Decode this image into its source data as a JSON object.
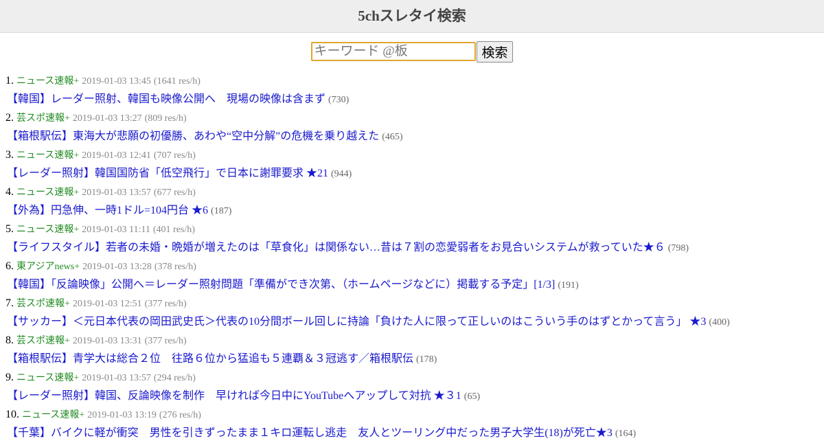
{
  "header": {
    "title": "5chスレタイ検索"
  },
  "search": {
    "placeholder": "キーワード @板",
    "button_label": "検索"
  },
  "results": [
    {
      "rank": "1.",
      "board": "ニュース速報+",
      "time": "2019-01-03 13:45",
      "rate": "(1641 res/h)",
      "title": "【韓国】レーダー照射、韓国も映像公開へ　現場の映像は含まず",
      "count": "(730)"
    },
    {
      "rank": "2.",
      "board": "芸スポ速報+",
      "time": "2019-01-03 13:27",
      "rate": "(809 res/h)",
      "title": "【箱根駅伝】東海大が悲願の初優勝、あわや“空中分解”の危機を乗り越えた",
      "count": "(465)"
    },
    {
      "rank": "3.",
      "board": "ニュース速報+",
      "time": "2019-01-03 12:41",
      "rate": "(707 res/h)",
      "title": "【レーダー照射】韓国国防省「低空飛行」で日本に謝罪要求 ★21",
      "count": "(944)"
    },
    {
      "rank": "4.",
      "board": "ニュース速報+",
      "time": "2019-01-03 13:57",
      "rate": "(677 res/h)",
      "title": "【外為】円急伸、一時1ドル=104円台 ★6",
      "count": "(187)"
    },
    {
      "rank": "5.",
      "board": "ニュース速報+",
      "time": "2019-01-03 11:11",
      "rate": "(401 res/h)",
      "title": "【ライフスタイル】若者の未婚・晩婚が増えたのは「草食化」は関係ない…昔は７割の恋愛弱者をお見合いシステムが救っていた★６",
      "count": "(798)"
    },
    {
      "rank": "6.",
      "board": "東アジアnews+",
      "time": "2019-01-03 13:28",
      "rate": "(378 res/h)",
      "title": "【韓国】「反論映像」公開へ＝レーダー照射問題「準備ができ次第、（ホームページなどに）掲載する予定」[1/3]",
      "count": "(191)"
    },
    {
      "rank": "7.",
      "board": "芸スポ速報+",
      "time": "2019-01-03 12:51",
      "rate": "(377 res/h)",
      "title": "【サッカー】＜元日本代表の岡田武史氏＞代表の10分間ボール回しに持論「負けた人に限って正しいのはこういう手のはずとかって言う」 ★3",
      "count": "(400)"
    },
    {
      "rank": "8.",
      "board": "芸スポ速報+",
      "time": "2019-01-03 13:31",
      "rate": "(377 res/h)",
      "title": "【箱根駅伝】青学大は総合２位　往路６位から猛追も５連覇＆３冠逃す／箱根駅伝",
      "count": "(178)"
    },
    {
      "rank": "9.",
      "board": "ニュース速報+",
      "time": "2019-01-03 13:57",
      "rate": "(294 res/h)",
      "title": "【レーダー照射】韓国、反論映像を制作　早ければ今日中にYouTubeへアップして対抗 ★３1",
      "count": "(65)"
    },
    {
      "rank": "10.",
      "board": "ニュース速報+",
      "time": "2019-01-03 13:19",
      "rate": "(276 res/h)",
      "title": "【千葉】バイクに軽が衝突　男性を引きずったまま１キロ運転し逃走　友人とツーリング中だった男子大学生(18)が死亡★3",
      "count": "(164)"
    }
  ]
}
